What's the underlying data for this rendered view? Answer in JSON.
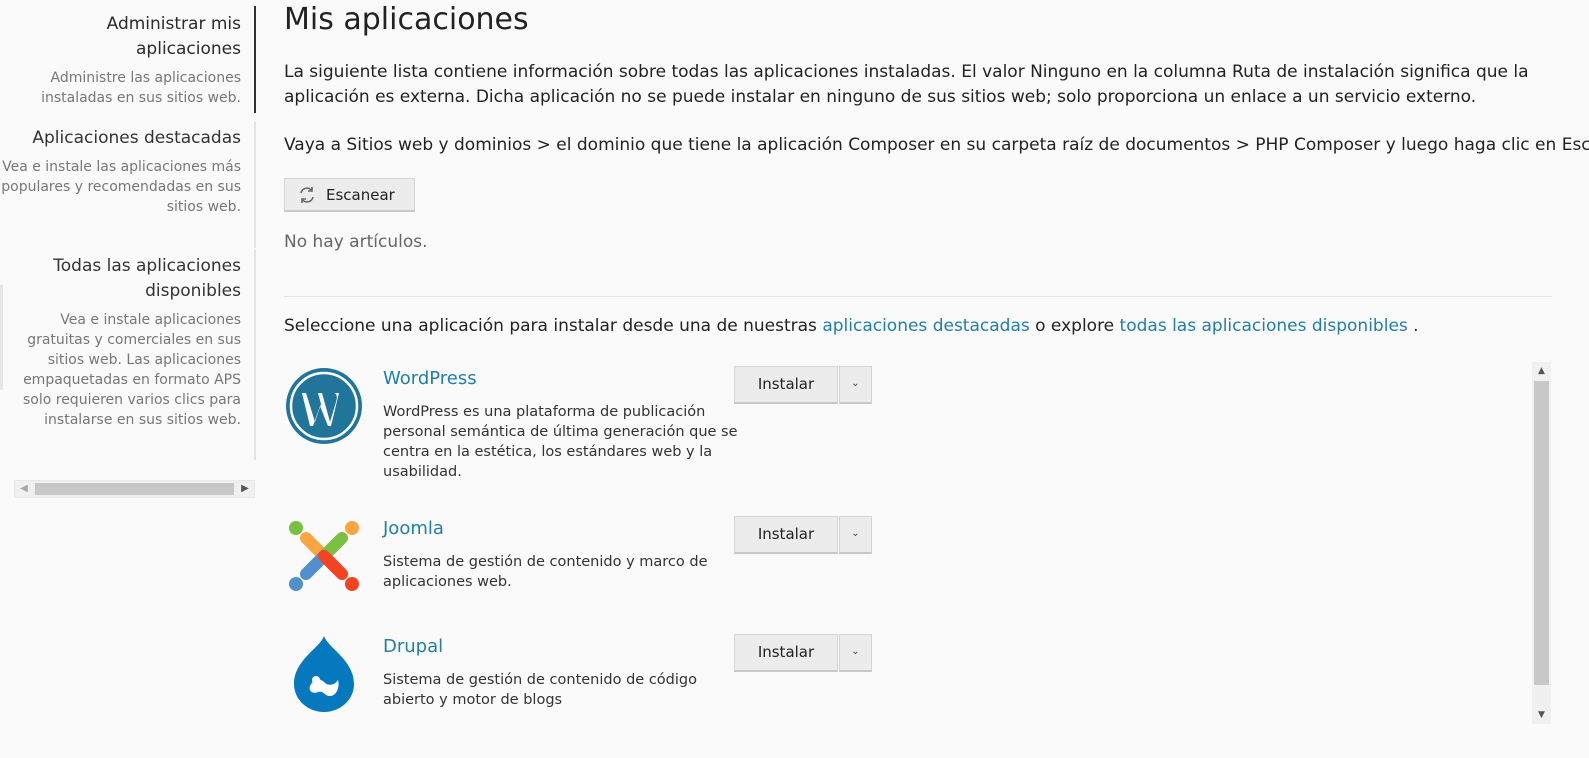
{
  "sidebar": {
    "items": [
      {
        "title": "Administrar mis aplicaciones",
        "desc": "Administre las aplicaciones instaladas en sus sitios web."
      },
      {
        "title": "Aplicaciones destacadas",
        "desc": "Vea e instale las aplicaciones más populares y recomendadas en sus sitios web."
      },
      {
        "title": "Todas las aplicaciones disponibles",
        "desc": "Vea e instale aplicaciones gratuitas y comerciales en sus sitios web. Las aplicaciones empaquetadas en formato APS solo requieren varios clics para instalarse en sus sitios web."
      }
    ]
  },
  "main": {
    "title": "Mis aplicaciones",
    "intro": "La siguiente lista contiene información sobre todas las aplicaciones instaladas. El valor Ninguno en la columna Ruta de instalación significa que la aplicación es externa. Dicha aplicación no se puede instalar en ninguno de sus sitios web; solo proporciona un enlace a un servicio externo.",
    "intro2": "Vaya a Sitios web y dominios > el dominio que tiene la aplicación Composer en su carpeta raíz de documentos > PHP Composer y luego haga clic en Escanear.",
    "scan_label": "Escanear",
    "empty": "No hay artículos.",
    "select_prefix": "Seleccione una aplicación para instalar desde una de nuestras",
    "featured_link": "aplicaciones destacadas",
    "select_mid": "o explore",
    "all_link": "todas las aplicaciones disponibles",
    "select_suffix": "."
  },
  "apps": [
    {
      "name": "WordPress",
      "desc": "WordPress es una plataforma de publicación personal semántica de última generación que se centra en la estética, los estándares web y la usabilidad.",
      "install_label": "Instalar",
      "dropdown_glyph": "⌄"
    },
    {
      "name": "Joomla",
      "desc": "Sistema de gestión de contenido y marco de aplicaciones web.",
      "install_label": "Instalar",
      "dropdown_glyph": "⌄"
    },
    {
      "name": "Drupal",
      "desc": "Sistema de gestión de contenido de código abierto y motor de blogs",
      "install_label": "Instalar",
      "dropdown_glyph": "⌄"
    }
  ],
  "colors": {
    "link": "#1f7fa8",
    "wordpress": "#21759b",
    "drupal": "#0678be"
  }
}
